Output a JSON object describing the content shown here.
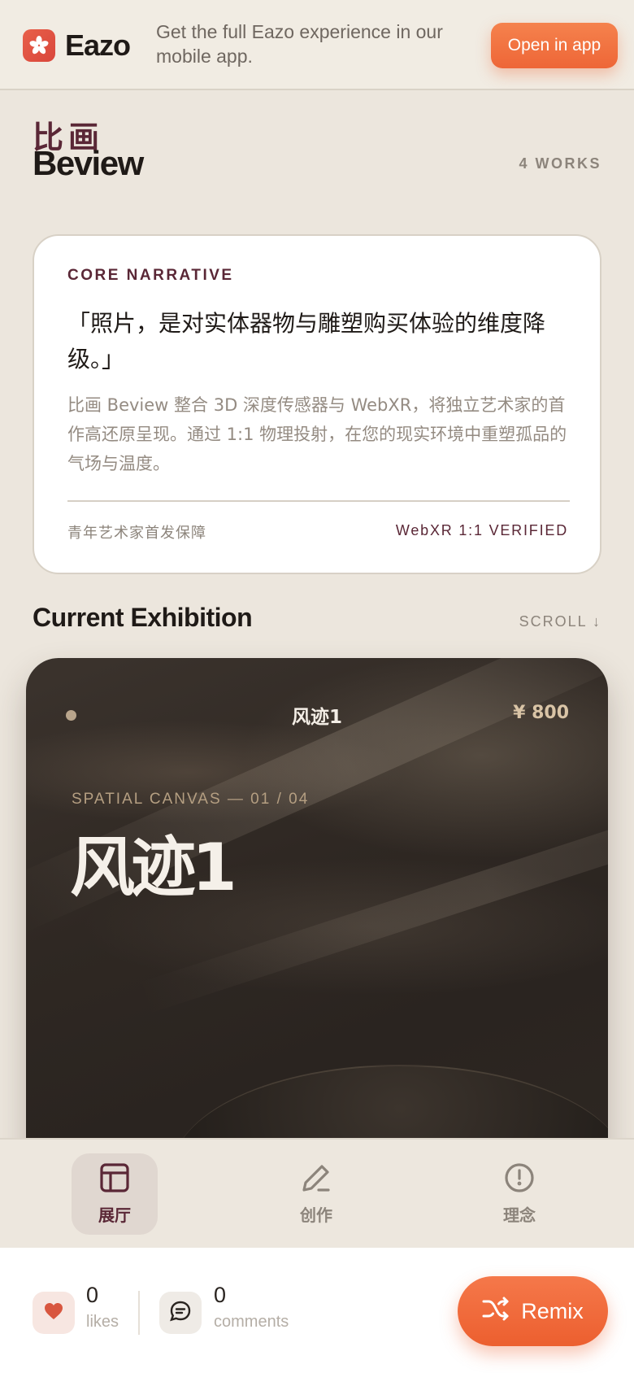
{
  "banner": {
    "brand_name": "Eazo",
    "message": "Get the full Eazo experience in our mobile app.",
    "open_button": "Open in app"
  },
  "header": {
    "title_cn": "比画",
    "title_en": "Beview",
    "works_count": "4 WORKS"
  },
  "narrative": {
    "label": "CORE NARRATIVE",
    "quote": "「照片，是对实体器物与雕塑购买体验的维度降级。」",
    "body": "比画 Beview 整合 3D 深度传感器与 WebXR，将独立艺术家的首作高还原呈现。通过 1:1 物理投射，在您的现实环境中重塑孤品的气场与温度。",
    "footer_left": "青年艺术家首发保障",
    "footer_right": "WebXR 1:1 VERIFIED"
  },
  "exhibition": {
    "section_title": "Current Exhibition",
    "scroll_hint": "SCROLL ↓",
    "card": {
      "title_small": "风迹1",
      "price": "¥ 800",
      "subtitle": "SPATIAL CANVAS — 01 / 04",
      "title_large": "风迹1"
    }
  },
  "tabbar": {
    "tabs": [
      {
        "label": "展厅",
        "icon": "layout-icon",
        "active": true
      },
      {
        "label": "创作",
        "icon": "pencil-icon",
        "active": false
      },
      {
        "label": "理念",
        "icon": "info-circle-icon",
        "active": false
      }
    ]
  },
  "actions": {
    "likes_count": "0",
    "likes_label": "likes",
    "comments_count": "0",
    "comments_label": "comments",
    "remix_label": "Remix"
  },
  "colors": {
    "accent_orange": "#ee6637",
    "brand_maroon": "#5a2736",
    "background": "#ece6dd"
  }
}
